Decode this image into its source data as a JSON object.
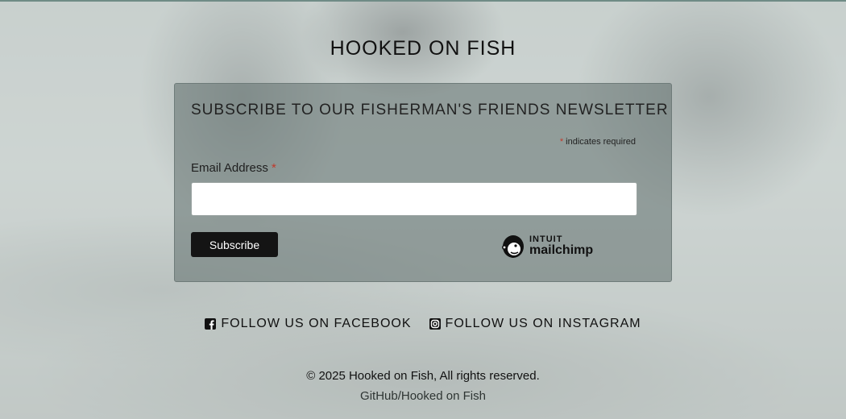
{
  "site": {
    "title": "HOOKED ON FISH"
  },
  "newsletter": {
    "title": "SUBSCRIBE TO OUR FISHERMAN'S FRIENDS NEWSLETTER",
    "required_note_asterisk": "*",
    "required_note": "indicates required",
    "email_label": "Email Address",
    "email_required_asterisk": "*",
    "email_value": "",
    "subscribe_label": "Subscribe",
    "badge_top": "INTUIT",
    "badge_bottom": "mailchimp"
  },
  "social": {
    "facebook_label": "FOLLOW US ON FACEBOOK",
    "facebook_icon": "facebook-square-icon",
    "instagram_label": "FOLLOW US ON INSTAGRAM",
    "instagram_icon": "instagram-icon"
  },
  "footer": {
    "copyright": "© 2025 Hooked on Fish, All rights reserved.",
    "repo_link": "GitHub/Hooked on Fish"
  }
}
